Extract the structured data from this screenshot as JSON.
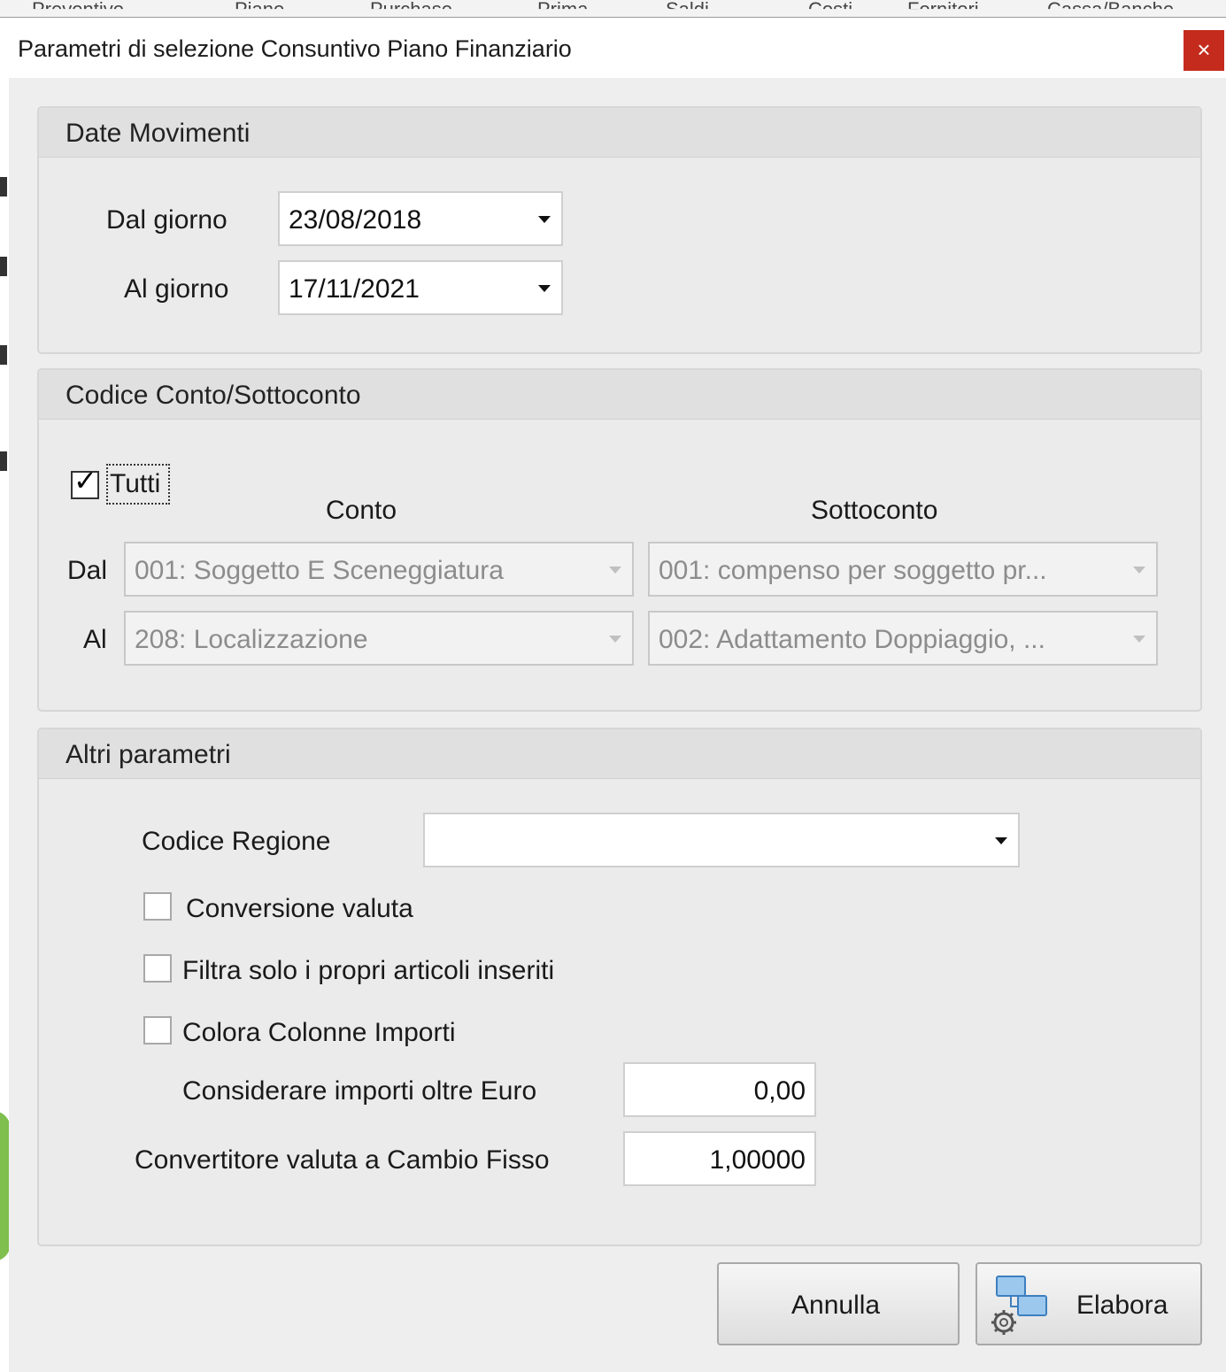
{
  "background": {
    "menu_items": [
      "Preventivo",
      "Piano",
      "Purchase",
      "Prima",
      "Saldi",
      "Costi",
      "Fornitori",
      "Cassa/Banche"
    ]
  },
  "dialog": {
    "title": "Parametri di selezione Consuntivo Piano Finanziario",
    "close_icon": "×"
  },
  "date_group": {
    "title": "Date Movimenti",
    "from_label": "Dal giorno",
    "from_value": "23/08/2018",
    "to_label": "Al giorno",
    "to_value": "17/11/2021"
  },
  "account_group": {
    "title": "Codice Conto/Sottoconto",
    "all_label": "Tutti",
    "all_checked": true,
    "conto_header": "Conto",
    "sottoconto_header": "Sottoconto",
    "from_label": "Dal",
    "to_label": "Al",
    "conto_from": "001: Soggetto E Sceneggiatura",
    "conto_to": "208: Localizzazione",
    "sottoconto_from": "001: compenso per soggetto pr...",
    "sottoconto_to": "002: Adattamento Doppiaggio, ..."
  },
  "other_group": {
    "title": "Altri parametri",
    "region_label": "Codice Regione",
    "region_value": "",
    "currency_conversion_label": "Conversione valuta",
    "own_items_label": "Filtra solo i propri articoli inseriti",
    "color_columns_label": "Colora Colonne Importi",
    "amount_threshold_label": "Considerare importi oltre Euro",
    "amount_threshold_value": "0,00",
    "fixed_rate_label": "Convertitore valuta a Cambio Fisso",
    "fixed_rate_value": "1,00000"
  },
  "buttons": {
    "cancel": "Annulla",
    "process": "Elabora"
  },
  "colors": {
    "close_button": "#c42b1c",
    "dialog_bg": "#eeeeee",
    "group_header": "#e0e0e0",
    "app_icon_blue": "#9cc8ee"
  },
  "icons": {
    "dropdown": "chevron-down-icon",
    "process_button": "process-settings-icon"
  }
}
